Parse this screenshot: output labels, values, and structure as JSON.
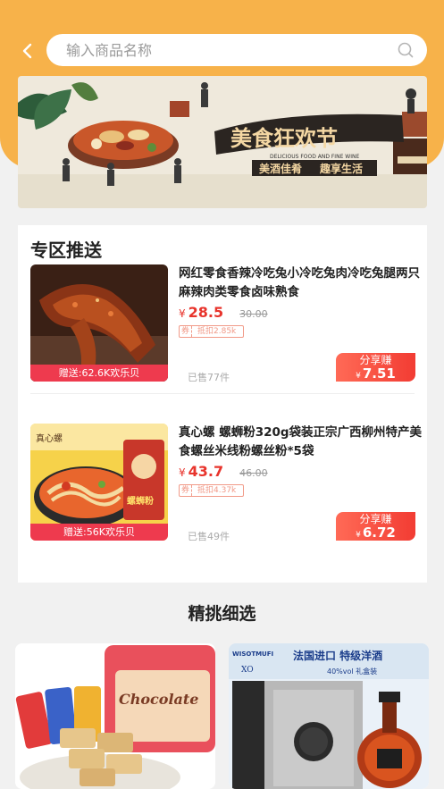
{
  "header": {
    "search_placeholder": "输入商品名称"
  },
  "banner": {
    "title": "美食狂欢节",
    "subtitle_en": "DELICIOUS FOOD AND FINE WINE",
    "slogan_left": "美酒佳肴",
    "slogan_right": "趣享生活"
  },
  "section": {
    "title": "专区推送",
    "products": [
      {
        "title": "网红零食香辣冷吃兔小冷吃兔肉冷吃兔腿两只麻辣肉类零食卤味熟食",
        "price_symbol": "¥",
        "price": "28.5",
        "original_price": "30.00",
        "coupon_tag": "券",
        "coupon_text": "抵扣2.85k",
        "sold": "已售77件",
        "gift": "赠送:62.6K欢乐贝",
        "share_label": "分享赚",
        "share_symbol": "¥",
        "share_value": "7.51"
      },
      {
        "title": "真心螺 螺蛳粉320g袋装正宗广西柳州特产美食螺丝米线粉螺丝粉*5袋",
        "price_symbol": "¥",
        "price": "43.7",
        "original_price": "46.00",
        "coupon_tag": "券",
        "coupon_text": "抵扣4.37k",
        "sold": "已售49件",
        "gift": "赠送:56K欢乐贝",
        "share_label": "分享赚",
        "share_symbol": "¥",
        "share_value": "6.72",
        "image_brand": "真心螺",
        "image_text": "螺蛳粉"
      }
    ]
  },
  "picks": {
    "title": "精挑细选",
    "items": [
      {
        "image_text": "Chocolate"
      },
      {
        "image_text": "法国进口 特级洋酒",
        "image_subtext": "40%vol 礼盒装",
        "brand": "WISOTMUFI",
        "grade": "XO"
      }
    ]
  },
  "colors": {
    "header_bg": "#f7b24a",
    "price_red": "#e8342c",
    "gift_red": "#ee3a4e"
  }
}
